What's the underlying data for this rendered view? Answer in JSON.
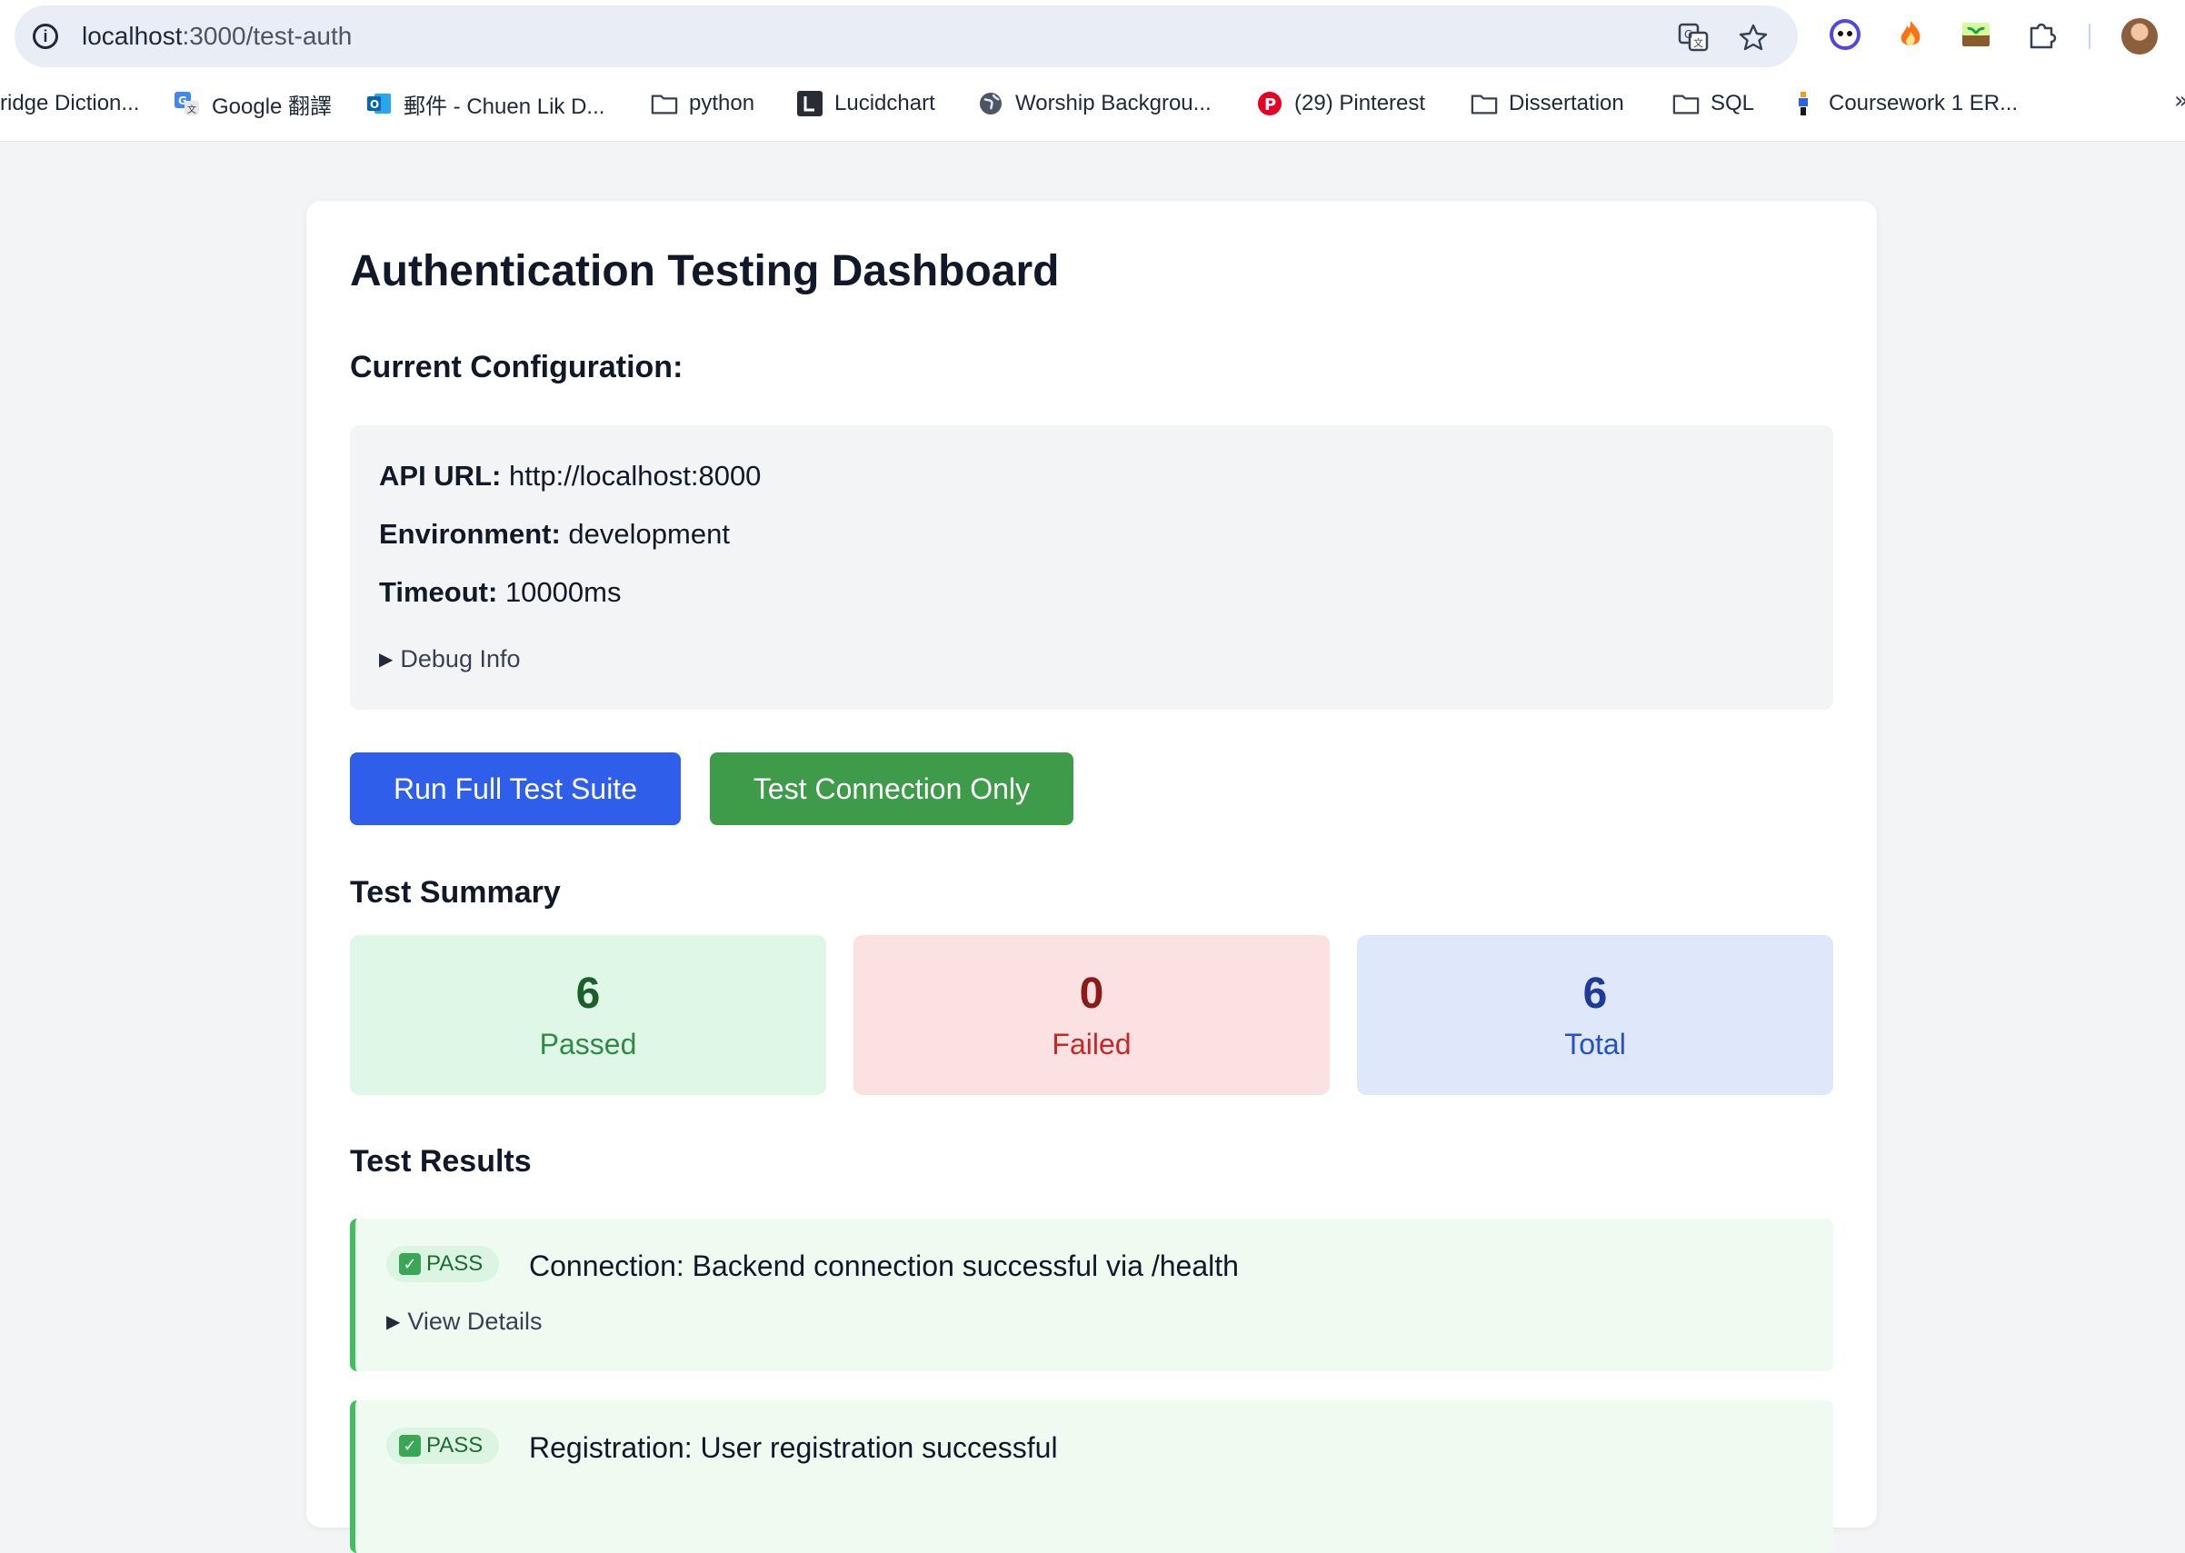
{
  "browser": {
    "url_host": "localhost",
    "url_path": ":3000/test-auth",
    "bookmarks": [
      {
        "label": "ridge Diction...",
        "icon": "none"
      },
      {
        "label": "Google 翻譯",
        "icon": "google-translate-icon"
      },
      {
        "label": "郵件 - Chuen Lik D...",
        "icon": "outlook-icon"
      },
      {
        "label": "python",
        "icon": "folder-icon"
      },
      {
        "label": "Lucidchart",
        "icon": "lucidchart-icon"
      },
      {
        "label": "Worship Backgrou...",
        "icon": "globe-icon"
      },
      {
        "label": "(29) Pinterest",
        "icon": "pinterest-icon"
      },
      {
        "label": "Dissertation",
        "icon": "folder-icon"
      },
      {
        "label": "SQL",
        "icon": "folder-icon"
      },
      {
        "label": "Coursework 1 ER...",
        "icon": "app-icon"
      }
    ],
    "overflow": "»"
  },
  "page": {
    "title": "Authentication Testing Dashboard",
    "config_heading": "Current Configuration:",
    "config": {
      "api_url_label": "API URL:",
      "api_url_value": "http://localhost:8000",
      "environment_label": "Environment:",
      "environment_value": "development",
      "timeout_label": "Timeout:",
      "timeout_value": "10000ms",
      "debug_label": "Debug Info"
    },
    "buttons": {
      "run_full": "Run Full Test Suite",
      "test_connection": "Test Connection Only"
    },
    "summary_heading": "Test Summary",
    "summary": {
      "passed_count": "6",
      "passed_label": "Passed",
      "failed_count": "0",
      "failed_label": "Failed",
      "total_count": "6",
      "total_label": "Total"
    },
    "results_heading": "Test Results",
    "results": [
      {
        "status": "PASS",
        "text": "Connection: Backend connection successful via /health",
        "details_label": "View Details"
      },
      {
        "status": "PASS",
        "text": "Registration: User registration successful"
      }
    ]
  },
  "colors": {
    "primary_button": "#2f5eea",
    "secondary_button": "#3d9b49",
    "pass_accent": "#3fbf5f"
  }
}
